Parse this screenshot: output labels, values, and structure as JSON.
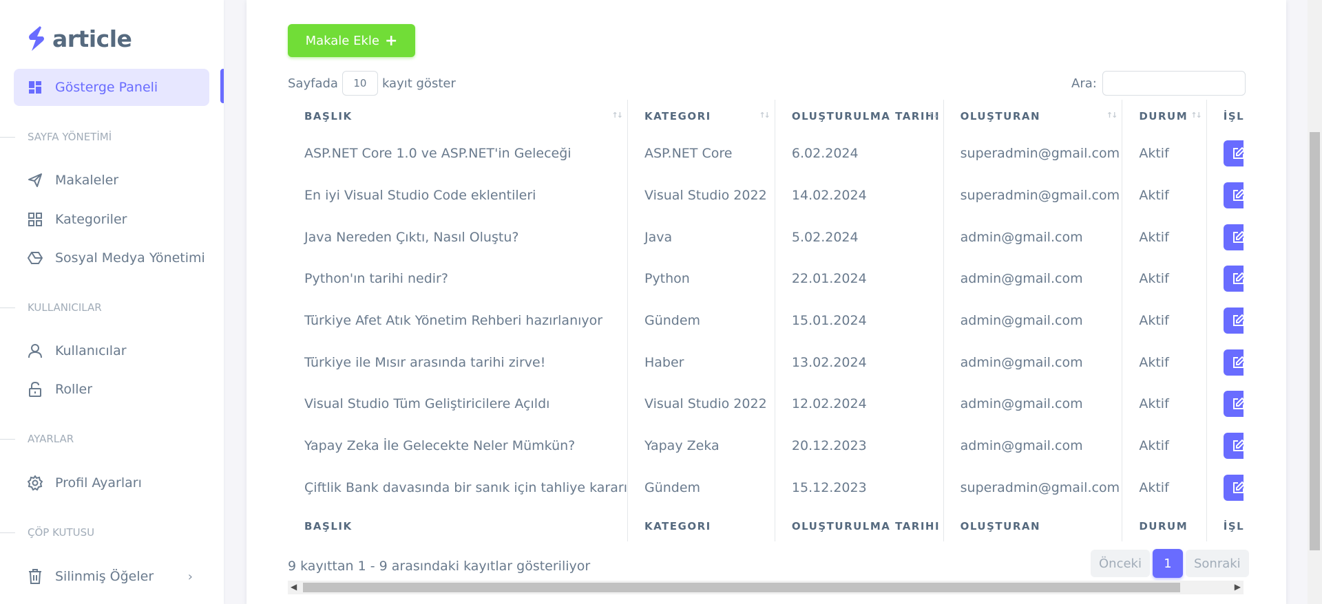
{
  "brand": {
    "name": "article"
  },
  "sidebar": {
    "dashboard": "Gösterge Paneli",
    "sections": {
      "page_management": "SAYFA YÖNETİMİ",
      "users": "KULLANICILAR",
      "settings": "AYARLAR",
      "trash": "ÇÖP KUTUSU"
    },
    "items": {
      "articles": "Makaleler",
      "categories": "Kategoriler",
      "social_media": "Sosyal Medya Yönetimi",
      "users": "Kullanıcılar",
      "roles": "Roller",
      "profile_settings": "Profil Ayarları",
      "deleted_items": "Silinmiş Öğeler"
    }
  },
  "main": {
    "add_button": "Makale Ekle",
    "length_prefix": "Sayfada",
    "length_value": "10",
    "length_suffix": "kayıt göster",
    "search_label": "Ara:",
    "columns": [
      "BAŞLIK",
      "KATEGORI",
      "OLUŞTURULMA TARIHI",
      "OLUŞTURAN",
      "DURUM",
      "İŞLE"
    ],
    "rows": [
      [
        "ASP.NET Core 1.0 ve ASP.NET'in Geleceği",
        "ASP.NET Core",
        "6.02.2024",
        "superadmin@gmail.com",
        "Aktif"
      ],
      [
        "En iyi Visual Studio Code eklentileri",
        "Visual Studio 2022",
        "14.02.2024",
        "superadmin@gmail.com",
        "Aktif"
      ],
      [
        "Java Nereden Çıktı, Nasıl Oluştu?",
        "Java",
        "5.02.2024",
        "admin@gmail.com",
        "Aktif"
      ],
      [
        "Python'ın tarihi nedir?",
        "Python",
        "22.01.2024",
        "admin@gmail.com",
        "Aktif"
      ],
      [
        "Türkiye Afet Atık Yönetim Rehberi hazırlanıyor",
        "Gündem",
        "15.01.2024",
        "admin@gmail.com",
        "Aktif"
      ],
      [
        "Türkiye ile Mısır arasında tarihi zirve!",
        "Haber",
        "13.02.2024",
        "admin@gmail.com",
        "Aktif"
      ],
      [
        "Visual Studio Tüm Geliştiricilere Açıldı",
        "Visual Studio 2022",
        "12.02.2024",
        "admin@gmail.com",
        "Aktif"
      ],
      [
        "Yapay Zeka İle Gelecekte Neler Mümkün?",
        "Yapay Zeka",
        "20.12.2023",
        "admin@gmail.com",
        "Aktif"
      ],
      [
        "Çiftlik Bank davasında bir sanık için tahliye kararı",
        "Gündem",
        "15.12.2023",
        "superadmin@gmail.com",
        "Aktif"
      ]
    ],
    "info": "9 kayıttan 1 - 9 arasındaki kayıtlar gösteriliyor",
    "pagination": {
      "prev": "Önceki",
      "current": "1",
      "next": "Sonraki"
    }
  },
  "colors": {
    "primary": "#696cff",
    "success": "#71dd37",
    "text": "#697a8d"
  }
}
